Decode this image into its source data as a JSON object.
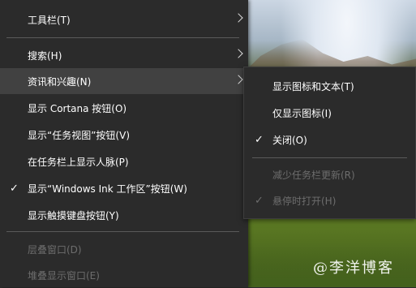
{
  "context_menu": {
    "items": [
      {
        "label": "工具栏(T)"
      },
      {
        "label": "搜索(H)"
      },
      {
        "label": "资讯和兴趣(N)"
      },
      {
        "label": "显示 Cortana 按钮(O)"
      },
      {
        "label": "显示“任务视图”按钮(V)"
      },
      {
        "label": "在任务栏上显示人脉(P)"
      },
      {
        "label": "显示“Windows Ink 工作区”按钮(W)"
      },
      {
        "label": "显示触摸键盘按钮(Y)"
      },
      {
        "label": "层叠窗口(D)"
      },
      {
        "label": "堆叠显示窗口(E)"
      }
    ]
  },
  "submenu": {
    "items": [
      {
        "label": "显示图标和文本(T)"
      },
      {
        "label": "仅显示图标(I)"
      },
      {
        "label": "关闭(O)"
      },
      {
        "label": "减少任务栏更新(R)"
      },
      {
        "label": "悬停时打开(H)"
      }
    ]
  },
  "glyphs": {
    "check": "✓"
  },
  "watermark": "@李洋博客"
}
